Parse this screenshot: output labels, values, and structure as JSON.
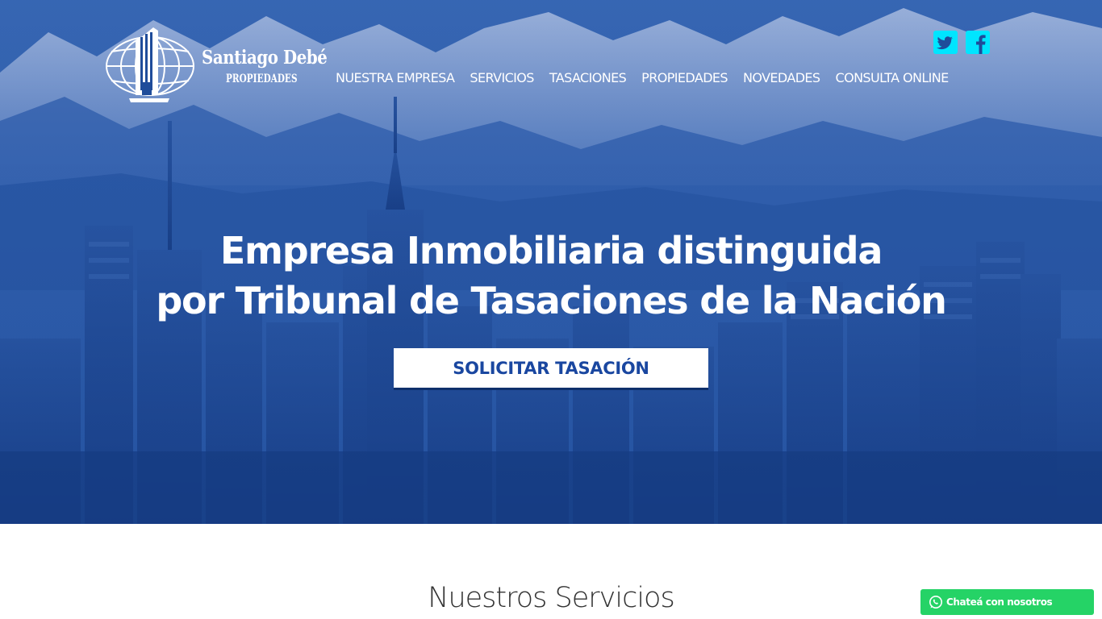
{
  "brand": {
    "name": "Santiago Debé",
    "sub": "PROPIEDADES"
  },
  "social": [
    {
      "icon": "twitter-icon",
      "color": "#00e5ff"
    },
    {
      "icon": "facebook-icon",
      "color": "#00e5ff"
    }
  ],
  "nav": {
    "items": [
      "NUESTRA EMPRESA",
      "SERVICIOS",
      "TASACIONES",
      "PROPIEDADES",
      "NOVEDADES",
      "CONSULTA ONLINE"
    ]
  },
  "hero": {
    "headline_line1": "Empresa Inmobiliaria distinguida",
    "headline_line2": "por Tribunal de Tasaciones de la Nación",
    "cta_label": "SOLICITAR TASACIÓN",
    "overlay_color": "#1f4c9a"
  },
  "services": {
    "title": "Nuestros Servicios"
  },
  "whatsapp": {
    "label": "Chateá con nosotros",
    "icon": "whatsapp-icon",
    "color": "#25d366"
  }
}
